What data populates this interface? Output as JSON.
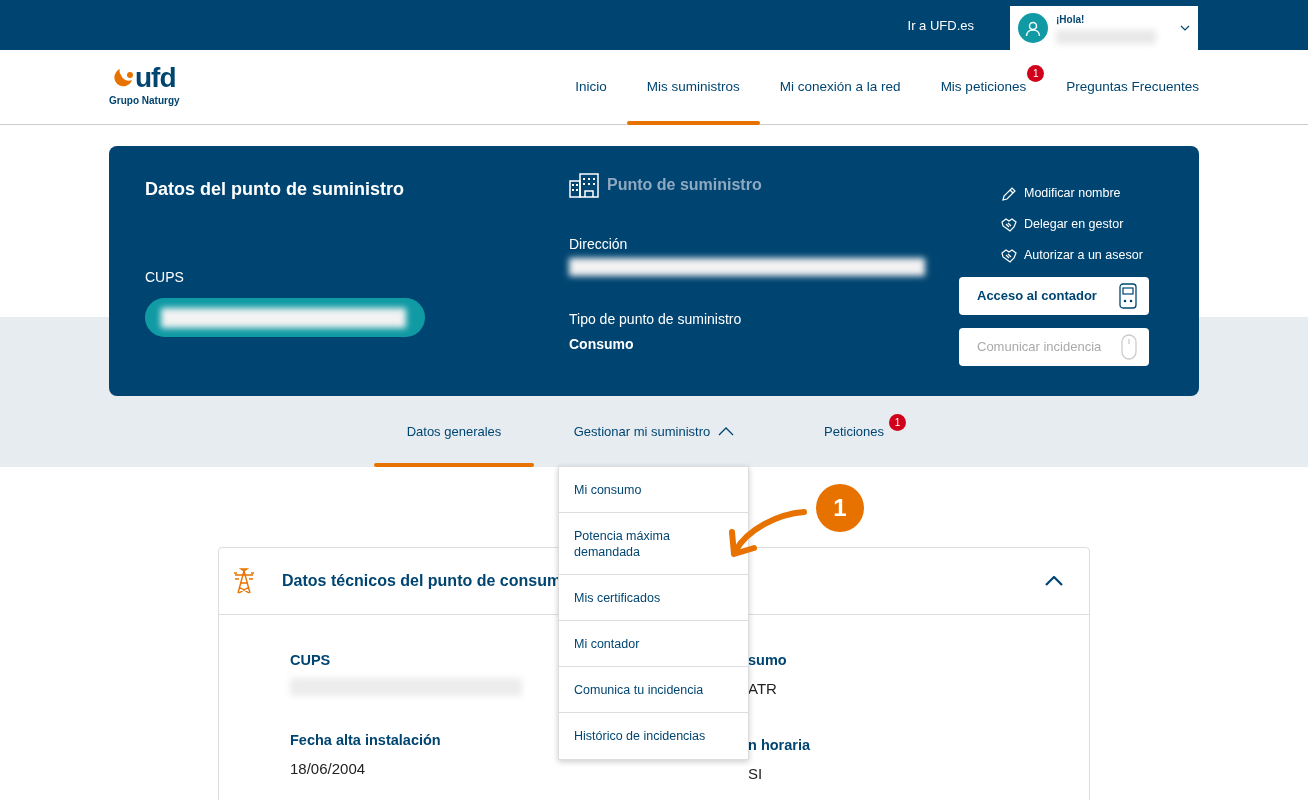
{
  "topbar": {
    "link": "Ir a UFD.es",
    "user": {
      "greeting": "¡Hola!"
    }
  },
  "logo": {
    "name": "ufd",
    "tagline": "Grupo Naturgy"
  },
  "nav": [
    {
      "label": "Inicio",
      "selected": false
    },
    {
      "label": "Mis suministros",
      "selected": true
    },
    {
      "label": "Mi conexión a la red",
      "selected": false
    },
    {
      "label": "Mis peticiones",
      "selected": false,
      "badge": "1"
    },
    {
      "label": "Preguntas Frecuentes",
      "selected": false
    }
  ],
  "supply_card": {
    "title": "Datos del punto de suministro",
    "cups_label": "CUPS",
    "point_title": "Punto de suministro",
    "address_label": "Dirección",
    "type_label": "Tipo de punto de suministro",
    "type_value": "Consumo",
    "actions": [
      {
        "label": "Modificar nombre",
        "kind": "edit"
      },
      {
        "label": "Delegar en gestor",
        "kind": "handshake"
      },
      {
        "label": "Autorizar a un asesor",
        "kind": "handshake"
      }
    ],
    "buttons": [
      {
        "label": "Acceso al contador",
        "disabled": false,
        "kind": "meter"
      },
      {
        "label": "Comunicar incidencia",
        "disabled": true,
        "kind": "mouse"
      }
    ]
  },
  "tabs": [
    {
      "label": "Datos generales",
      "selected": true
    },
    {
      "label": "Gestionar mi suministro",
      "selected": false,
      "expanded": true
    },
    {
      "label": "Peticiones",
      "selected": false,
      "badge": "1"
    }
  ],
  "dropdown": [
    {
      "label": "Mi consumo"
    },
    {
      "label": "Potencia máxima\ndemandada"
    },
    {
      "label": "Mis certificados"
    },
    {
      "label": "Mi contador"
    },
    {
      "label": "Comunica tu incidencia"
    },
    {
      "label": "Histórico de incidencias"
    }
  ],
  "callout": {
    "number": "1"
  },
  "panel": {
    "title": "Datos técnicos del punto de consum",
    "expanded": true,
    "fields_left": [
      {
        "label": "CUPS"
      },
      {
        "label": "Fecha alta instalación",
        "value": "18/06/2004"
      }
    ],
    "fields_right": [
      {
        "label": "sumo",
        "value": "ATR"
      },
      {
        "label": "n horaria",
        "value": "SI"
      }
    ]
  }
}
